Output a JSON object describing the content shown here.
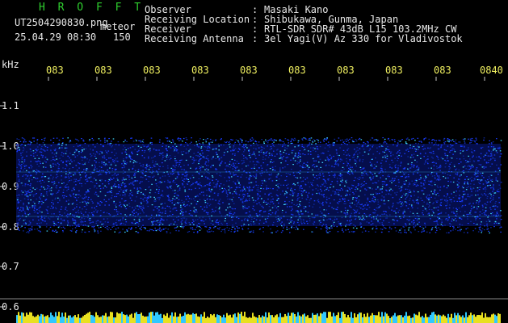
{
  "header": {
    "title": "H R O F F T",
    "filename": "UT2504290830.png",
    "meteor_label": "meteor",
    "datetime": "25.04.29 08:30",
    "meteor_count": "150",
    "fields": [
      {
        "label": "Observer",
        "value": "Masaki Kano"
      },
      {
        "label": "Receiving Location",
        "value": "Shibukawa, Gunma, Japan"
      },
      {
        "label": "Receiver",
        "value": "RTL-SDR SDR# 43dB L15 103.2MHz CW"
      },
      {
        "label": "Receiving Antenna",
        "value": "3el Yagi(V) Az 330 for Vladivostok"
      }
    ],
    "colon": ":"
  },
  "axis": {
    "unit": "kHz",
    "y_ticks": [
      "1.1",
      "1.0",
      "0.9",
      "0.8",
      "0.7",
      "0.6"
    ],
    "time_ticks": [
      "083",
      "083",
      "083",
      "083",
      "083",
      "083",
      "083",
      "083",
      "083",
      "0840"
    ]
  },
  "colors": {
    "background": "#000000",
    "signal": "#1a3cff",
    "signal_bright": "#40d8ff",
    "label_yellow": "#f0f060",
    "label_green": "#2fd02f",
    "baseline_yellow": "#e8e020",
    "baseline_cyan": "#30c8ff"
  }
}
